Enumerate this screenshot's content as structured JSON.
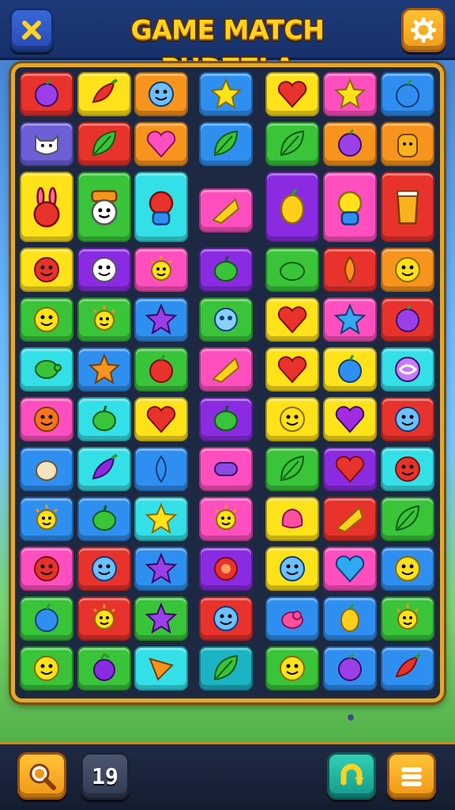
{
  "header": {
    "title": "GAME MATCH PUDZZLA",
    "close_icon": "close-x-icon",
    "settings_icon": "gear-icon"
  },
  "colors": {
    "red": "#e8322c",
    "yellow": "#ffe21a",
    "orange": "#f7941d",
    "blue": "#2f8ff0",
    "green": "#39c43a",
    "purple": "#8a2be2",
    "pink": "#ff4fbf",
    "cyan": "#34e0e8",
    "lavender": "#6d5fd6",
    "teal": "#1cb3c4"
  },
  "board": {
    "columns": 7,
    "rows": [
      [
        {
          "bg": "red",
          "icon": "purple-berry",
          "tall": false
        },
        {
          "bg": "yellow",
          "icon": "red-chili",
          "tall": false
        },
        {
          "bg": "orange",
          "icon": "blue-smiley",
          "tall": false
        },
        {
          "bg": "blue",
          "icon": "yellow-star",
          "tall": false
        },
        {
          "bg": "yellow",
          "icon": "red-heart",
          "tall": false
        },
        {
          "bg": "pink",
          "icon": "yellow-star",
          "tall": false
        },
        {
          "bg": "blue",
          "icon": "blue-berry",
          "tall": false
        }
      ],
      [
        {
          "bg": "lavender",
          "icon": "white-cat",
          "tall": false
        },
        {
          "bg": "red",
          "icon": "green-leaf",
          "tall": false
        },
        {
          "bg": "orange",
          "icon": "pink-heart",
          "tall": false
        },
        {
          "bg": "blue",
          "icon": "green-leaf",
          "tall": false
        },
        {
          "bg": "green",
          "icon": "green-leaf",
          "tall": false
        },
        {
          "bg": "orange",
          "icon": "purple-berry",
          "tall": false
        },
        {
          "bg": "orange",
          "icon": "orange-creature",
          "tall": false
        }
      ],
      [
        {
          "bg": "yellow",
          "icon": "red-bunny",
          "tall": true
        },
        {
          "bg": "green",
          "icon": "hat-smiley",
          "tall": true
        },
        {
          "bg": "cyan",
          "icon": "red-monster",
          "tall": true
        },
        {
          "bg": "pink",
          "icon": "yellow-wedge",
          "tall": false
        },
        {
          "bg": "purple",
          "icon": "yellow-squash",
          "tall": true
        },
        {
          "bg": "pink",
          "icon": "blue-monster",
          "tall": true
        },
        {
          "bg": "red",
          "icon": "orange-cup",
          "tall": true
        }
      ],
      [
        {
          "bg": "yellow",
          "icon": "red-smiley",
          "tall": false
        },
        {
          "bg": "purple",
          "icon": "white-smiley",
          "tall": false
        },
        {
          "bg": "pink",
          "icon": "yellow-sun",
          "tall": false
        },
        {
          "bg": "purple",
          "icon": "green-berry",
          "tall": false
        },
        {
          "bg": "green",
          "icon": "green-blob",
          "tall": false
        },
        {
          "bg": "red",
          "icon": "orange-drop",
          "tall": false
        },
        {
          "bg": "orange",
          "icon": "yellow-smiley",
          "tall": false
        }
      ],
      [
        {
          "bg": "green",
          "icon": "yellow-smiley",
          "tall": false
        },
        {
          "bg": "green",
          "icon": "yellow-sun",
          "tall": false
        },
        {
          "bg": "blue",
          "icon": "purple-star",
          "tall": false
        },
        {
          "bg": "green",
          "icon": "blue-ghost",
          "tall": false
        },
        {
          "bg": "yellow",
          "icon": "red-heart",
          "tall": false
        },
        {
          "bg": "pink",
          "icon": "blue-star",
          "tall": false
        },
        {
          "bg": "red",
          "icon": "purple-berry",
          "tall": false
        }
      ],
      [
        {
          "bg": "cyan",
          "icon": "green-turtle",
          "tall": false
        },
        {
          "bg": "blue",
          "icon": "orange-star",
          "tall": false
        },
        {
          "bg": "green",
          "icon": "red-berry",
          "tall": false
        },
        {
          "bg": "pink",
          "icon": "yellow-wedge",
          "tall": false
        },
        {
          "bg": "yellow",
          "icon": "red-heart",
          "tall": false
        },
        {
          "bg": "yellow",
          "icon": "blue-berry",
          "tall": false
        },
        {
          "bg": "cyan",
          "icon": "pink-swirl",
          "tall": false
        }
      ],
      [
        {
          "bg": "pink",
          "icon": "orange-smiley",
          "tall": false
        },
        {
          "bg": "cyan",
          "icon": "green-berry",
          "tall": false
        },
        {
          "bg": "yellow",
          "icon": "red-heart",
          "tall": false
        },
        {
          "bg": "purple",
          "icon": "green-berry",
          "tall": false
        },
        {
          "bg": "yellow",
          "icon": "yellow-smiley",
          "tall": false
        },
        {
          "bg": "yellow",
          "icon": "purple-heart",
          "tall": false
        },
        {
          "bg": "red",
          "icon": "blue-smiley",
          "tall": false
        }
      ],
      [
        {
          "bg": "blue",
          "icon": "cream-shell",
          "tall": false
        },
        {
          "bg": "cyan",
          "icon": "purple-chili",
          "tall": false
        },
        {
          "bg": "blue",
          "icon": "blue-drop",
          "tall": false
        },
        {
          "bg": "pink",
          "icon": "purple-pill",
          "tall": false
        },
        {
          "bg": "green",
          "icon": "green-leaf",
          "tall": false
        },
        {
          "bg": "purple",
          "icon": "red-heart",
          "tall": false
        },
        {
          "bg": "cyan",
          "icon": "red-smiley",
          "tall": false
        }
      ],
      [
        {
          "bg": "blue",
          "icon": "yellow-sun",
          "tall": false
        },
        {
          "bg": "blue",
          "icon": "green-berry",
          "tall": false
        },
        {
          "bg": "cyan",
          "icon": "yellow-star",
          "tall": false
        },
        {
          "bg": "pink",
          "icon": "yellow-sun",
          "tall": false
        },
        {
          "bg": "yellow",
          "icon": "pink-blob",
          "tall": false
        },
        {
          "bg": "red",
          "icon": "yellow-wedge",
          "tall": false
        },
        {
          "bg": "green",
          "icon": "green-leaf",
          "tall": false
        }
      ],
      [
        {
          "bg": "pink",
          "icon": "red-smiley",
          "tall": false
        },
        {
          "bg": "red",
          "icon": "blue-smiley",
          "tall": false
        },
        {
          "bg": "blue",
          "icon": "purple-star",
          "tall": false
        },
        {
          "bg": "purple",
          "icon": "red-ball",
          "tall": false
        },
        {
          "bg": "yellow",
          "icon": "blue-smiley",
          "tall": false
        },
        {
          "bg": "pink",
          "icon": "blue-heart",
          "tall": false
        },
        {
          "bg": "blue",
          "icon": "yellow-smiley",
          "tall": false
        }
      ],
      [
        {
          "bg": "green",
          "icon": "blue-berry",
          "tall": false
        },
        {
          "bg": "red",
          "icon": "yellow-sun",
          "tall": false
        },
        {
          "bg": "green",
          "icon": "purple-star",
          "tall": false
        },
        {
          "bg": "red",
          "icon": "blue-smiley",
          "tall": false
        },
        {
          "bg": "blue",
          "icon": "pink-bird",
          "tall": false
        },
        {
          "bg": "blue",
          "icon": "yellow-squash",
          "tall": false
        },
        {
          "bg": "green",
          "icon": "yellow-sun",
          "tall": false
        }
      ],
      [
        {
          "bg": "green",
          "icon": "yellow-smiley",
          "tall": false
        },
        {
          "bg": "green",
          "icon": "purple-grape",
          "tall": false
        },
        {
          "bg": "cyan",
          "icon": "orange-wedge",
          "tall": false
        },
        {
          "bg": "teal",
          "icon": "green-leaf",
          "tall": false
        },
        {
          "bg": "green",
          "icon": "yellow-smiley",
          "tall": false
        },
        {
          "bg": "blue",
          "icon": "purple-berry",
          "tall": false
        },
        {
          "bg": "blue",
          "icon": "red-chili",
          "tall": false
        }
      ]
    ]
  },
  "footer": {
    "hint_icon": "magnifier-hint-icon",
    "moves_value": "19",
    "undo_icon": "undo-icon",
    "menu_icon": "menu-icon"
  }
}
